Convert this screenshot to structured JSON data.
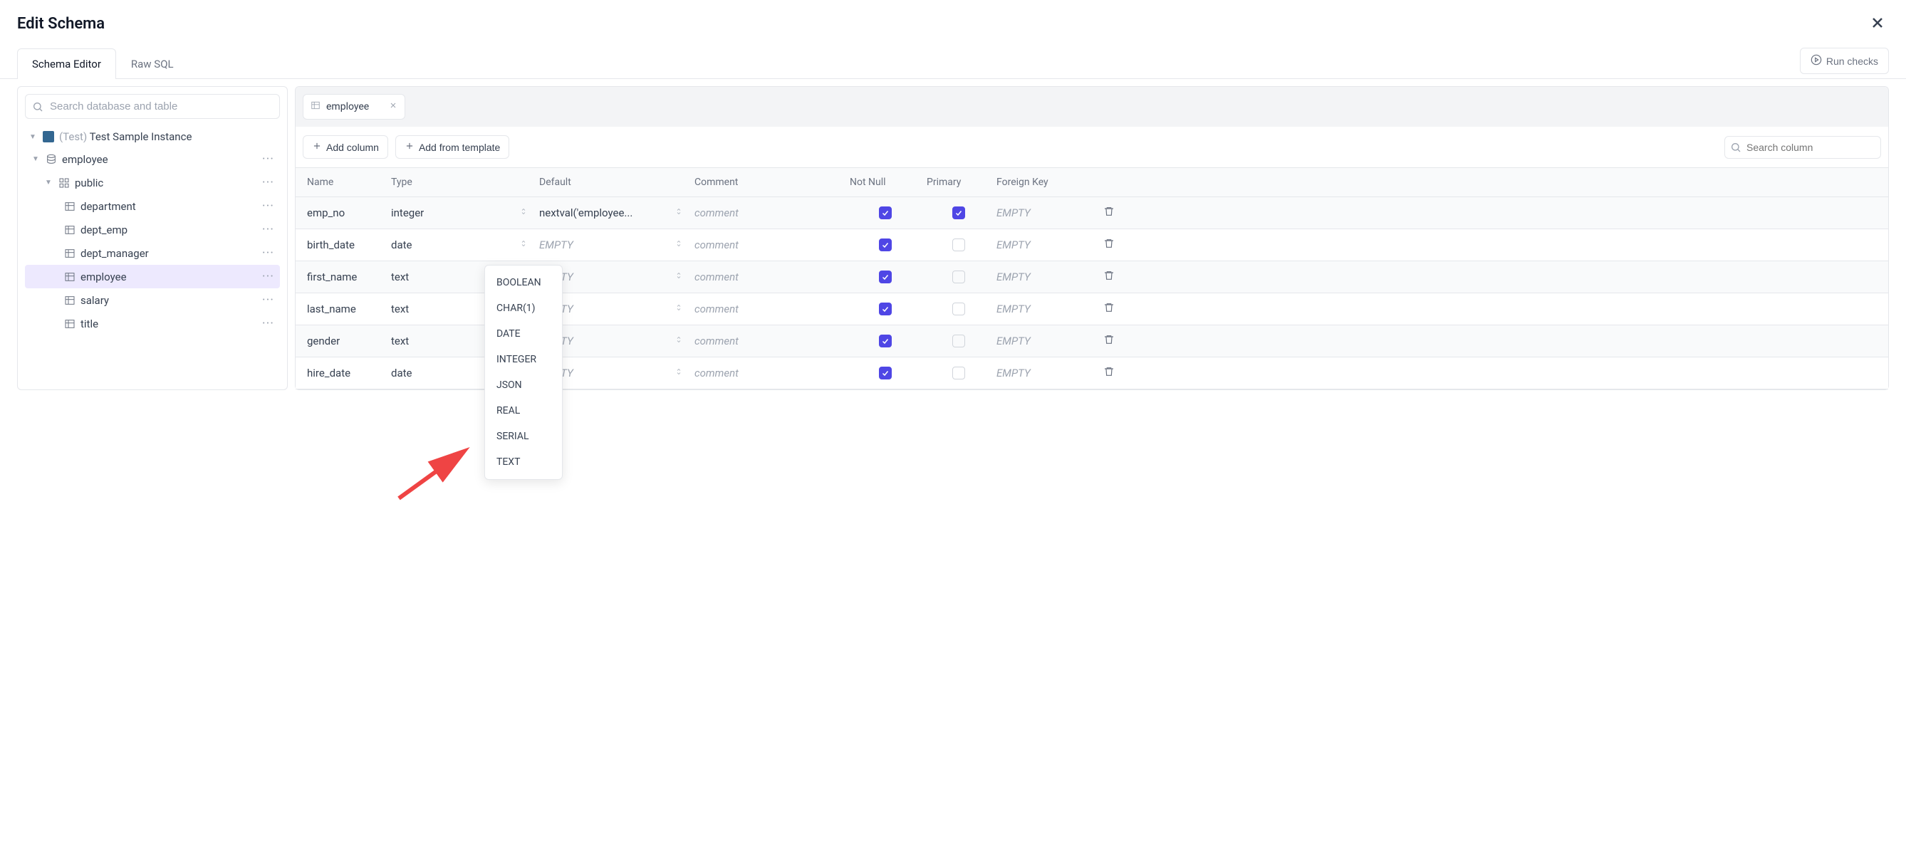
{
  "modal": {
    "title": "Edit Schema"
  },
  "tabs": {
    "schema_editor": "Schema Editor",
    "raw_sql": "Raw SQL"
  },
  "run_checks": "Run checks",
  "sidebar": {
    "search_placeholder": "Search database and table",
    "instance_prefix": "(Test)",
    "instance_name": "Test Sample Instance",
    "items": [
      {
        "label": "employee",
        "type": "database"
      },
      {
        "label": "public",
        "type": "schema"
      },
      {
        "label": "department",
        "type": "table"
      },
      {
        "label": "dept_emp",
        "type": "table"
      },
      {
        "label": "dept_manager",
        "type": "table"
      },
      {
        "label": "employee",
        "type": "table",
        "selected": true
      },
      {
        "label": "salary",
        "type": "table"
      },
      {
        "label": "title",
        "type": "table"
      }
    ]
  },
  "file_tab": {
    "label": "employee"
  },
  "toolbar": {
    "add_column": "Add column",
    "add_template": "Add from template",
    "search_placeholder": "Search column"
  },
  "grid": {
    "headers": {
      "name": "Name",
      "type": "Type",
      "default": "Default",
      "comment": "Comment",
      "not_null": "Not Null",
      "primary": "Primary",
      "foreign_key": "Foreign Key"
    },
    "empty_text": "EMPTY",
    "comment_placeholder": "comment",
    "rows": [
      {
        "name": "emp_no",
        "type": "integer",
        "default": "nextval('employee...",
        "not_null": true,
        "primary": true
      },
      {
        "name": "birth_date",
        "type": "date",
        "default": "",
        "not_null": true,
        "primary": false
      },
      {
        "name": "first_name",
        "type": "text",
        "default": "",
        "not_null": true,
        "primary": false
      },
      {
        "name": "last_name",
        "type": "text",
        "default": "",
        "not_null": true,
        "primary": false
      },
      {
        "name": "gender",
        "type": "text",
        "default": "",
        "not_null": true,
        "primary": false
      },
      {
        "name": "hire_date",
        "type": "date",
        "default": "",
        "not_null": true,
        "primary": false
      }
    ]
  },
  "type_dropdown": [
    "BOOLEAN",
    "CHAR(1)",
    "DATE",
    "INTEGER",
    "JSON",
    "REAL",
    "SERIAL",
    "TEXT"
  ]
}
